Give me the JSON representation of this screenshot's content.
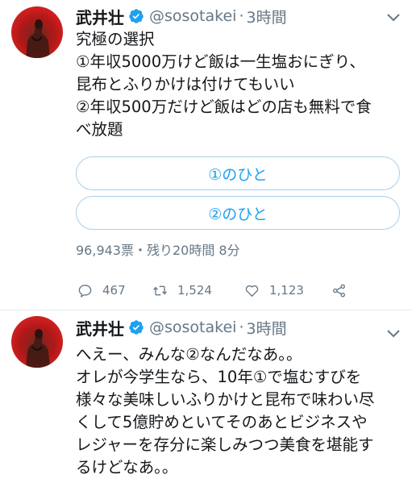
{
  "tweets": [
    {
      "name": "武井壮",
      "handle": "@sosotakei",
      "separator": "·",
      "time": "3時間",
      "lines": [
        "究極の選択",
        "①年収5000万けど飯は一生塩おにぎり、",
        "昆布とふりかけは付けてもいい",
        "②年収500万だけど飯はどの店も無料で食",
        "べ放題"
      ],
      "poll": {
        "options": [
          "①のひと",
          "②のひと"
        ],
        "meta": "96,943票・残り20時間 8分"
      },
      "actions": {
        "reply_count": "467",
        "retweet_count": "1,524",
        "like_count": "1,123"
      }
    },
    {
      "name": "武井壮",
      "handle": "@sosotakei",
      "separator": "·",
      "time": "3時間",
      "lines": [
        "へえー、みんな②なんだなあ。。",
        "オレが今学生なら、10年①で塩むすびを",
        "様々な美味しいふりかけと昆布で味わい尽",
        "くして5億貯めといてそのあとビジネスや",
        "レジャーを存分に楽しみつつ美食を堪能す",
        "るけどなあ。。"
      ]
    }
  ],
  "colors": {
    "accent": "#1da1f2",
    "muted": "#657786",
    "text": "#14171a",
    "verified": "#1da1f2"
  },
  "icons": [
    "verified-badge-icon",
    "chevron-down-icon",
    "reply-icon",
    "retweet-icon",
    "like-icon",
    "share-icon"
  ]
}
